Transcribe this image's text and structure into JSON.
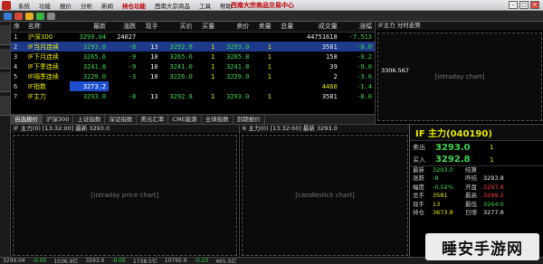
{
  "menubar": {
    "items": [
      "系统",
      "功能",
      "报价",
      "分析",
      "新闻",
      "持仓功能",
      "西南大宗商品",
      "工具",
      "帮助"
    ],
    "title": "西南大宗商品交易中心"
  },
  "quote_table": {
    "headers": [
      "序",
      "名称",
      "最新",
      "涨跌",
      "现手",
      "买价",
      "买量",
      "卖价",
      "卖量",
      "总量",
      "成交量",
      "涨幅"
    ],
    "rows": [
      {
        "idx": "1",
        "name": "沪深300",
        "last": "3299.04",
        "chg": "24027",
        "hand": "",
        "bid": "",
        "bidv": "",
        "ask": "",
        "askv": "",
        "tot": "",
        "vol": "44751618",
        "pct": "-7.513"
      },
      {
        "idx": "2",
        "name": "IF当月连续",
        "last": "3293.0",
        "chg": "-8",
        "hand": "13",
        "bid": "3292.8",
        "bidv": "1",
        "ask": "3293.0",
        "askv": "1",
        "tot": "",
        "vol": "3581",
        "pct": "-8.0"
      },
      {
        "idx": "3",
        "name": "IF下月连续",
        "last": "3265.6",
        "chg": "-9",
        "hand": "10",
        "bid": "3265.6",
        "bidv": "1",
        "ask": "3265.8",
        "askv": "1",
        "tot": "",
        "vol": "158",
        "pct": "-9.2"
      },
      {
        "idx": "4",
        "name": "IF下季连续",
        "last": "3241.8",
        "chg": "-9",
        "hand": "10",
        "bid": "3241.0",
        "bidv": "1",
        "ask": "3241.8",
        "askv": "1",
        "tot": "",
        "vol": "39",
        "pct": "-9.0"
      },
      {
        "idx": "5",
        "name": "IF隔季连续",
        "last": "3229.0",
        "chg": "-3",
        "hand": "10",
        "bid": "3226.0",
        "bidv": "1",
        "ask": "3229.0",
        "askv": "1",
        "tot": "",
        "vol": "2",
        "pct": "-3.6"
      },
      {
        "idx": "6",
        "name": "IF指数",
        "last": "3273.2",
        "chg": "",
        "hand": "",
        "bid": "",
        "bidv": "",
        "ask": "",
        "askv": "",
        "tot": "",
        "vol": "4460",
        "pct": "-1.4"
      },
      {
        "idx": "7",
        "name": "IF主力",
        "last": "3293.0",
        "chg": "-8",
        "hand": "13",
        "bid": "3292.8",
        "bidv": "1",
        "ask": "3293.0",
        "askv": "1",
        "tot": "",
        "vol": "3581",
        "pct": "-8.0"
      }
    ]
  },
  "tabs": [
    "自选报价",
    "沪深300",
    "上证指数",
    "深证指数",
    "美元汇率",
    "CME能源",
    "全球指数",
    "到期报价"
  ],
  "mini_chart": {
    "header": "IF主力 分时走势",
    "price": "3306.567"
  },
  "bottom_left_header": "IF 主力(0) [13:32:00] 最新 3293.0",
  "bottom_mid_header": "K 主力(0) [13:32:00] 最新 3293.0",
  "price_panel": {
    "title": "IF  主力(040190)",
    "sell_label": "卖出",
    "sell_price": "3293.0",
    "sell_vol": "1",
    "buy_label": "买入",
    "buy_price": "3292.8",
    "buy_vol": "1",
    "stats": [
      {
        "l1": "最新",
        "v1": "3293.0",
        "l2": "结算",
        "v2": ""
      },
      {
        "l1": "涨跌",
        "v1": "-8",
        "l2": "昨结",
        "v2": "3293.8"
      },
      {
        "l1": "幅度",
        "v1": "-0.02%",
        "l2": "开盘",
        "v2": "3297.8"
      },
      {
        "l1": "总手",
        "v1": "3581",
        "l2": "最高",
        "v2": "3299.2"
      },
      {
        "l1": "现手",
        "v1": "13",
        "l2": "最低",
        "v2": "3264.0"
      },
      {
        "l1": "持仓",
        "v1": "3673.8",
        "l2": "日增",
        "v2": "3277.8"
      }
    ]
  },
  "statusbar": [
    "3299.04",
    "-0.05",
    "1036.9亿",
    "3293.0",
    "-0.05",
    "1738.5亿",
    "10795.6",
    "-0.23",
    "465.5亿"
  ],
  "watermark": "睡安手游网"
}
